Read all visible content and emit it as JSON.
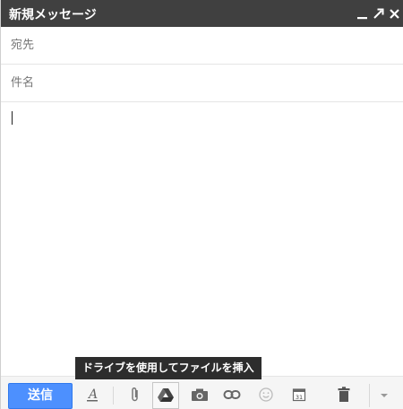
{
  "compose": {
    "title": "新規メッセージ",
    "to_placeholder": "宛先",
    "subject_placeholder": "件名",
    "send_label": "送信",
    "drive_tooltip": "ドライブを使用してファイルを挿入",
    "calendar_day": "31"
  },
  "icons": {
    "minimize": "minimize-icon",
    "popout": "popout-icon",
    "close": "close-icon",
    "format": "text-format-icon",
    "attach": "paperclip-icon",
    "drive": "drive-icon",
    "photo": "camera-icon",
    "link": "link-icon",
    "emoji": "emoji-icon",
    "calendar": "calendar-icon",
    "trash": "trash-icon",
    "more": "chevron-down-icon"
  },
  "colors": {
    "titlebar": "#404040",
    "send_button": "#4d90fe",
    "toolbar_bg": "#f5f5f5",
    "tooltip_bg": "#2d2d2d"
  }
}
